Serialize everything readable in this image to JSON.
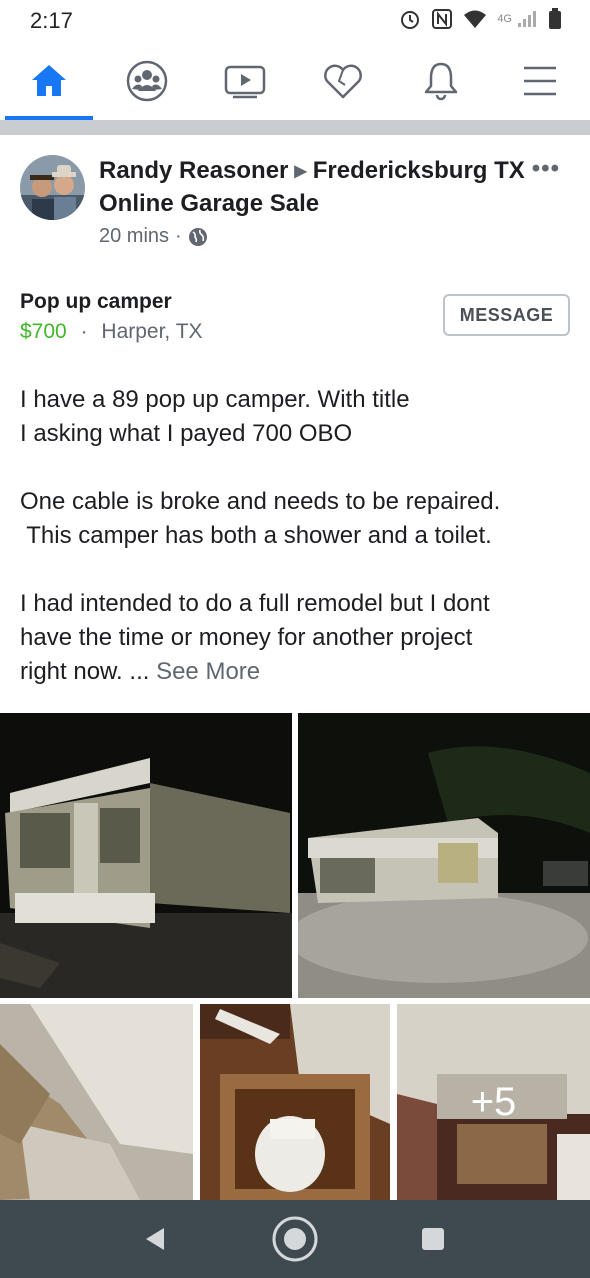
{
  "status_bar": {
    "time": "2:17",
    "network": "4G",
    "battery": "26"
  },
  "nav": {
    "items": [
      {
        "name": "home",
        "icon": "home-icon",
        "active": true
      },
      {
        "name": "groups",
        "icon": "groups-icon",
        "active": false
      },
      {
        "name": "watch",
        "icon": "video-icon",
        "active": false
      },
      {
        "name": "dating",
        "icon": "heart-icon",
        "active": false
      },
      {
        "name": "notifications",
        "icon": "bell-icon",
        "active": false
      },
      {
        "name": "menu",
        "icon": "menu-icon",
        "active": false
      }
    ],
    "accent_color": "#1877f2"
  },
  "post": {
    "author": "Randy Reasoner",
    "group": "Fredericksburg TX Online Garage Sale",
    "time": "20 mins",
    "separator": "·",
    "privacy_icon": "globe-icon",
    "listing": {
      "title": "Pop up camper",
      "price": "$700",
      "price_color": "#42b72a",
      "location": "Harper, TX",
      "message_button": "MESSAGE"
    },
    "text": {
      "line1": "I have a 89 pop up camper. With title",
      "line2": "I asking what I payed 700 OBO",
      "line3": "One cable is broke and needs to be repaired.",
      "line4": " This camper has both a shower and a toilet.",
      "line5": "I had intended to do a full remodel but I dont",
      "line6": "have the time or money for another project",
      "line7": "right now. ...",
      "see_more": "See More"
    },
    "photos": {
      "more_count": "+5"
    }
  },
  "system_nav": {
    "back": "back-icon",
    "home": "home-circle-icon",
    "recents": "recents-icon"
  }
}
